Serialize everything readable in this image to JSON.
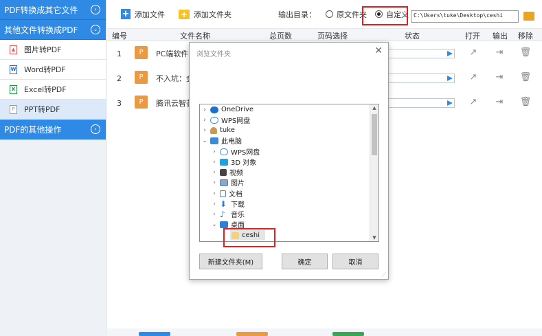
{
  "sidebar": {
    "sections": [
      {
        "label": "PDF转换成其它文件",
        "icon": "chevron-right-circle-icon"
      },
      {
        "label": "其他文件转换成PDF",
        "icon": "chevron-down-circle-icon"
      }
    ],
    "items": [
      {
        "label": "图片转PDF",
        "icon": "image-file-icon"
      },
      {
        "label": "Word转PDF",
        "icon": "word-file-icon"
      },
      {
        "label": "Excel转PDF",
        "icon": "excel-file-icon"
      },
      {
        "label": "PPT转PDF",
        "icon": "ppt-file-icon",
        "active": true
      }
    ],
    "bottom_section": {
      "label": "PDF的其他操作",
      "icon": "chevron-right-circle-icon"
    }
  },
  "toolbar": {
    "add_file": "添加文件",
    "add_folder": "添加文件夹",
    "output_label": "输出目录：",
    "radio_original": "原文件夹",
    "radio_custom": "自定义",
    "custom_selected": true,
    "path_value": "C:\\Users\\tuke\\Desktop\\ceshi"
  },
  "table": {
    "headers": {
      "num": "编号",
      "name": "文件名称",
      "pages": "总页数",
      "range": "页码选择",
      "status": "状态",
      "open": "打开",
      "output": "输出",
      "remove": "移除"
    },
    "rows": [
      {
        "num": "1",
        "badge": "P",
        "name": "PC端软件"
      },
      {
        "num": "2",
        "badge": "P",
        "name": "不入坑：金"
      },
      {
        "num": "3",
        "badge": "P",
        "name": "腾讯云智荟"
      }
    ]
  },
  "dialog": {
    "title": "浏览文件夹",
    "tree": [
      {
        "label": "OneDrive",
        "level": 0,
        "chevron": ">",
        "icon": "cloud-icon",
        "color": "#1e6fd0"
      },
      {
        "label": "WPS网盘",
        "level": 0,
        "chevron": ">",
        "icon": "cloud-outline-icon",
        "color": "#2f8ae5"
      },
      {
        "label": "tuke",
        "level": 0,
        "chevron": ">",
        "icon": "user-icon",
        "color": "#c89a5a"
      },
      {
        "label": "此电脑",
        "level": 0,
        "chevron": "v",
        "icon": "computer-icon",
        "color": "#3a8ad6"
      },
      {
        "label": "WPS网盘",
        "level": 1,
        "chevron": ">",
        "icon": "cloud-outline-icon",
        "color": "#2f8ae5"
      },
      {
        "label": "3D 对象",
        "level": 1,
        "chevron": ">",
        "icon": "cube-icon",
        "color": "#1fa3d8"
      },
      {
        "label": "视频",
        "level": 1,
        "chevron": ">",
        "icon": "video-icon",
        "color": "#444"
      },
      {
        "label": "图片",
        "level": 1,
        "chevron": ">",
        "icon": "picture-icon",
        "color": "#5a7ea8"
      },
      {
        "label": "文档",
        "level": 1,
        "chevron": ">",
        "icon": "document-icon",
        "color": "#6a7b8c"
      },
      {
        "label": "下载",
        "level": 1,
        "chevron": ">",
        "icon": "download-icon",
        "color": "#2f7fd6"
      },
      {
        "label": "音乐",
        "level": 1,
        "chevron": ">",
        "icon": "music-icon",
        "color": "#2f7fd6"
      },
      {
        "label": "桌面",
        "level": 1,
        "chevron": "v",
        "icon": "desktop-icon",
        "color": "#2f7fd6"
      },
      {
        "label": "ceshi",
        "level": 2,
        "chevron": "",
        "icon": "folder-icon",
        "color": "#f3d27a",
        "selected": true
      }
    ],
    "buttons": {
      "new_folder": "新建文件夹(M)",
      "ok": "确定",
      "cancel": "取消"
    }
  },
  "colors": {
    "accent": "#2f8ae5",
    "highlight": "#e02020",
    "ppt_badge": "#e99a42"
  }
}
